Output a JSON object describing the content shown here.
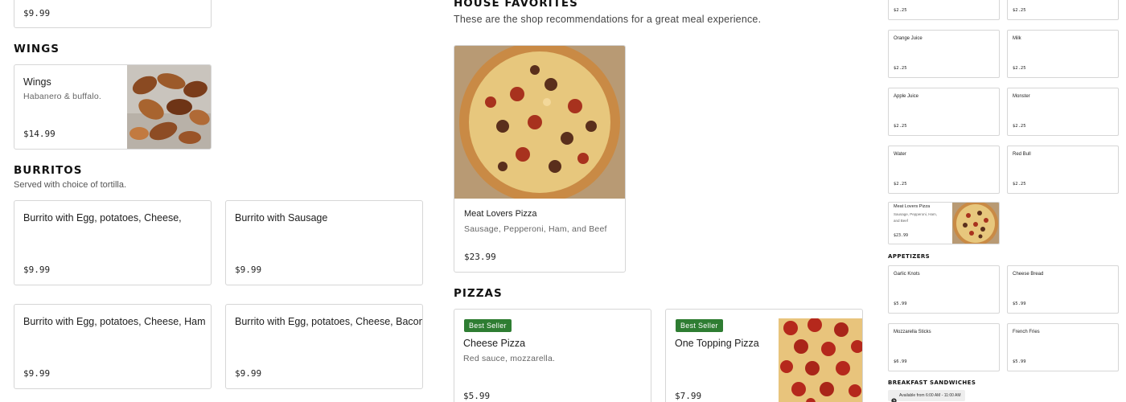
{
  "top_card": {
    "price": "$9.99"
  },
  "wings": {
    "heading": "WINGS",
    "item": {
      "title": "Wings",
      "desc": "Habanero & buffalo.",
      "price": "$14.99"
    }
  },
  "burritos": {
    "heading": "BURRITOS",
    "subheading": "Served with choice of tortilla.",
    "items": [
      {
        "title": "Burrito with Egg, potatoes, Cheese,",
        "price": "$9.99"
      },
      {
        "title": "Burrito with Sausage",
        "price": "$9.99"
      },
      {
        "title": "Burrito with Egg, potatoes, Cheese, Ham",
        "price": "$9.99"
      },
      {
        "title": "Burrito with Egg, potatoes, Cheese, Bacon",
        "price": "$9.99"
      }
    ]
  },
  "house_favorites": {
    "heading": "HOUSE FAVORITES",
    "subheading": "These are the shop recommendations for a great meal experience.",
    "item": {
      "title": "Meat Lovers Pizza",
      "desc": "Sausage, Pepperoni, Ham, and Beef",
      "price": "$23.99"
    }
  },
  "pizzas": {
    "heading": "PIZZAS",
    "items": [
      {
        "badge": "Best Seller",
        "title": "Cheese Pizza",
        "desc": "Red sauce, mozzarella.",
        "price": "$5.99"
      },
      {
        "badge": "Best Seller",
        "title": "One Topping Pizza",
        "price": "$7.99"
      }
    ]
  },
  "sidebar": {
    "top_prices": [
      "$2.25",
      "$2.25"
    ],
    "drinks": [
      {
        "title": "Orange Juice",
        "price": "$2.25"
      },
      {
        "title": "Milk",
        "price": "$2.25"
      },
      {
        "title": "Apple Juice",
        "price": "$2.25"
      },
      {
        "title": "Monster",
        "price": "$2.25"
      },
      {
        "title": "Water",
        "price": "$2.25"
      },
      {
        "title": "Red Bull",
        "price": "$2.25"
      }
    ],
    "featured": {
      "title": "Meat Lovers Pizza",
      "desc": "Sausage, Pepperoni, Ham, and Beef",
      "price": "$23.99"
    },
    "appetizers_heading": "APPETIZERS",
    "appetizers": [
      {
        "title": "Garlic Knots",
        "price": "$5.99"
      },
      {
        "title": "Cheese Bread",
        "price": "$5.99"
      },
      {
        "title": "Mozzarella Sticks",
        "price": "$6.99"
      },
      {
        "title": "French Fries",
        "price": "$5.99"
      }
    ],
    "breakfast_heading": "BREAKFAST SANDWICHES",
    "availability": "Available from 6:00 AM - 11:00 AM",
    "clock_icon": "clock-icon"
  }
}
